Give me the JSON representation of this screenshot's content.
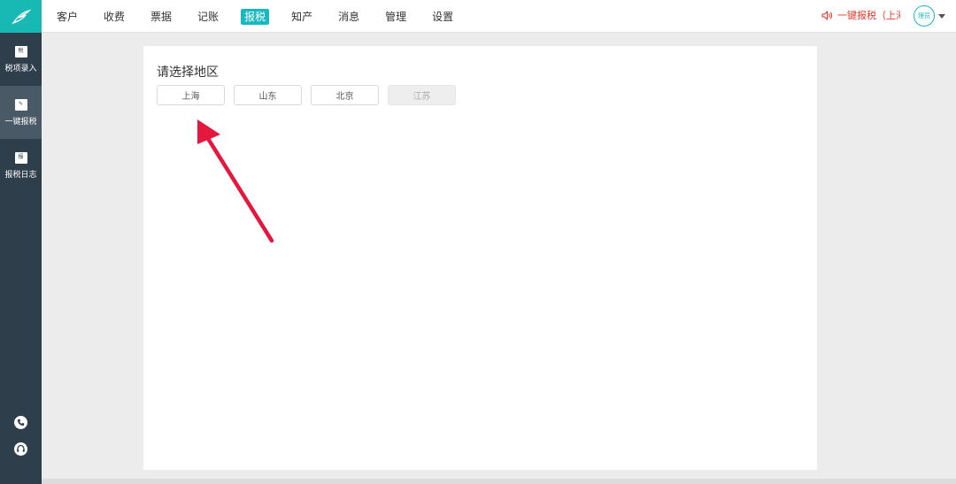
{
  "nav": {
    "items": [
      "客户",
      "收费",
      "票据",
      "记账",
      "报税",
      "知产",
      "消息",
      "管理",
      "设置"
    ],
    "active_index": 4
  },
  "header": {
    "quick_tax_label": "一键报税（上海",
    "avatar_text": "理员"
  },
  "sidebar": {
    "items": [
      {
        "label": "税项录入",
        "icon": "tax-entry-icon",
        "icon_glyph": "税"
      },
      {
        "label": "一键报税",
        "icon": "edit-icon",
        "icon_glyph": "✎"
      },
      {
        "label": "报税日志",
        "icon": "log-icon",
        "icon_glyph": "报"
      }
    ],
    "active_index": 1
  },
  "main": {
    "title": "请选择地区",
    "regions": [
      {
        "label": "上海",
        "enabled": true
      },
      {
        "label": "山东",
        "enabled": true
      },
      {
        "label": "北京",
        "enabled": true
      },
      {
        "label": "江苏",
        "enabled": false
      }
    ]
  },
  "colors": {
    "accent": "#18b8c1",
    "sidebar_bg": "#2f3e4b",
    "alert_red": "#e8392d",
    "annotation_arrow": "#e5173f"
  }
}
